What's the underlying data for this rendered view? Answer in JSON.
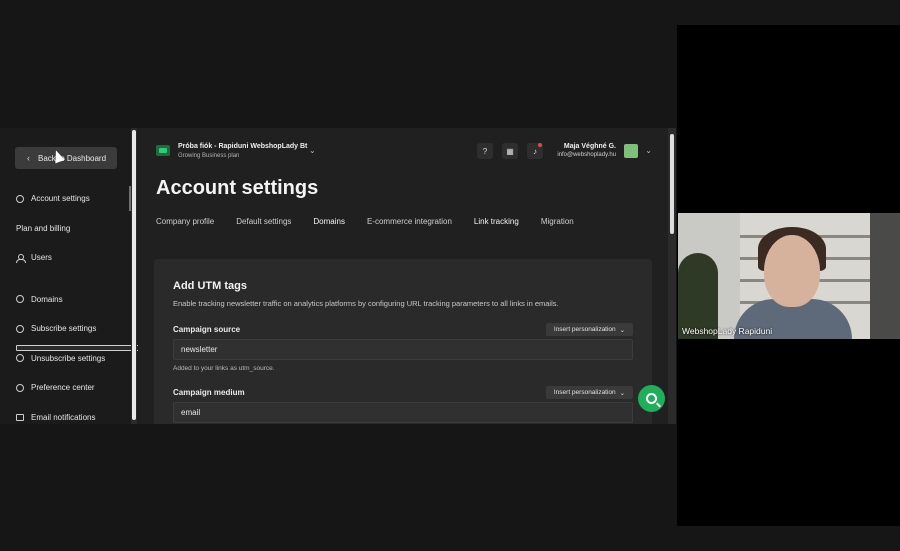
{
  "sidebar": {
    "back_label": "Back to Dashboard",
    "items": [
      {
        "label": "Account settings",
        "icon": "gear-icon"
      },
      {
        "label": "Plan and billing",
        "icon": "card-icon"
      },
      {
        "label": "Users",
        "icon": "user-icon"
      },
      {
        "label": "Domains",
        "icon": "globe-icon"
      },
      {
        "label": "Subscribe settings",
        "icon": "gear-icon"
      },
      {
        "label": "Unsubscribe settings",
        "icon": "gear-icon"
      },
      {
        "label": "Preference center",
        "icon": "gear-icon"
      },
      {
        "label": "Email notifications",
        "icon": "envelope-icon"
      }
    ]
  },
  "header": {
    "account_name": "Próba fiók - Rapiduni WebshopLady Bt",
    "account_plan": "Growing Business plan",
    "user_name": "Maja Véghné G.",
    "user_email": "info@webshoplady.hu"
  },
  "page": {
    "title": "Account settings",
    "tabs": [
      "Company profile",
      "Default settings",
      "Domains",
      "E-commerce integration",
      "Link tracking",
      "Migration"
    ]
  },
  "utm": {
    "title": "Add UTM tags",
    "description": "Enable tracking newsletter traffic on analytics platforms by configuring URL tracking parameters to all links in emails.",
    "insert_label": "Insert personalization",
    "source_label": "Campaign source",
    "source_value": "newsletter",
    "source_hint": "Added to your links as utm_source.",
    "medium_label": "Campaign medium",
    "medium_value": "email"
  },
  "video": {
    "participant": "WebshopLady Rapiduni"
  },
  "colors": {
    "accent_green": "#1fae5a",
    "notification_red": "#e8473c"
  }
}
